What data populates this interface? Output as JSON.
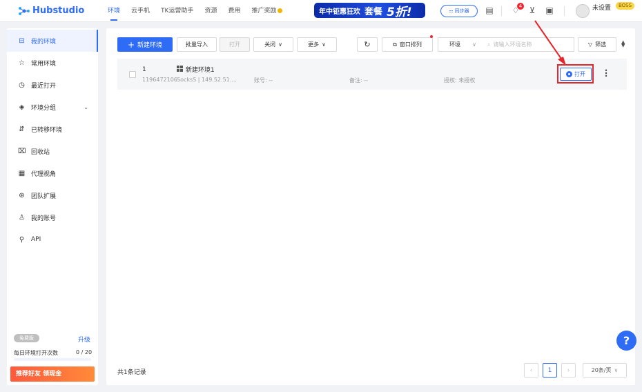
{
  "app": {
    "logo_text": "Hubstudio"
  },
  "nav": {
    "items": [
      "环境",
      "云手机",
      "TK运营助手",
      "资源",
      "费用",
      "推广奖励"
    ],
    "active": "环境"
  },
  "banner": {
    "text1": "年中钜惠狂欢",
    "text2": "套餐",
    "text3": "5折!"
  },
  "header": {
    "sync_label": "同步器",
    "notification_count": "4",
    "username": "未设置",
    "plan_badge": "BOSS"
  },
  "sidebar": {
    "items": [
      {
        "label": "我的环境",
        "icon": "environment-icon"
      },
      {
        "label": "常用环境",
        "icon": "star-icon"
      },
      {
        "label": "最近打开",
        "icon": "clock-icon"
      },
      {
        "label": "环境分组",
        "icon": "group-icon"
      },
      {
        "label": "已转移环境",
        "icon": "transfer-icon"
      },
      {
        "label": "回收站",
        "icon": "trash-icon"
      },
      {
        "label": "代理视角",
        "icon": "proxy-icon"
      },
      {
        "label": "团队扩展",
        "icon": "team-icon"
      },
      {
        "label": "我的账号",
        "icon": "user-icon"
      },
      {
        "label": "API",
        "icon": "api-icon"
      }
    ],
    "plan_label": "免费版",
    "upgrade_label": "升级",
    "daily_label": "每日环境打开次数",
    "daily_count": "0 / 20",
    "daily_progress": 0,
    "invite_label": "推荐好友 领现金"
  },
  "toolbar": {
    "new_env": "新建环境",
    "batch_import": "批量导入",
    "open": "打开",
    "close": "关闭",
    "more": "更多",
    "window_arrange": "窗口排列",
    "env_select": "环境",
    "search_placeholder": "请输入环境名称",
    "filter": "筛选"
  },
  "table": {
    "rows": [
      {
        "index": "1",
        "id": "1196472106",
        "name": "新建环境1",
        "proxy": "SocksS | 149.52.51....",
        "account": "账号: --",
        "remark": "备注: --",
        "auth": "授权: 未授权",
        "open_label": "打开"
      }
    ]
  },
  "footer": {
    "total": "共1条记录",
    "page": "1",
    "page_size": "20条/页"
  },
  "colors": {
    "accent": "#2f6cf6",
    "annotation": "#e5262a"
  }
}
